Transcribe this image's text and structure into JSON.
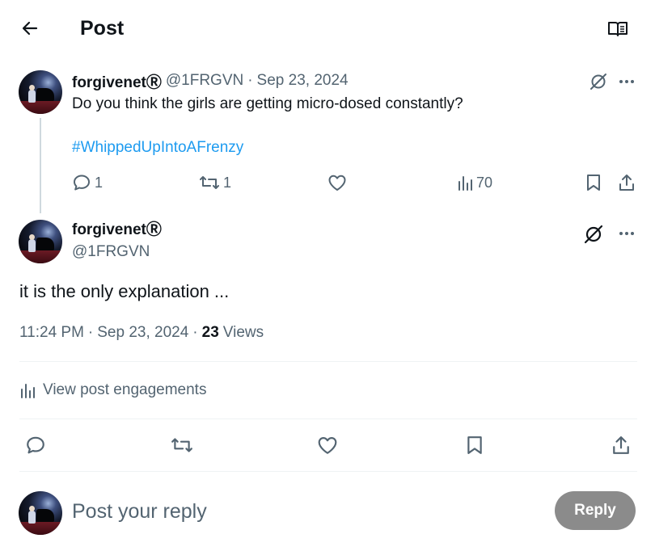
{
  "header": {
    "title": "Post",
    "back_icon": "arrow-left-icon",
    "reader_icon": "book-open-icon"
  },
  "parent_post": {
    "author_name": "forgivenetⓇ",
    "handle": "@1FRGVN",
    "separator": "·",
    "date": "Sep 23, 2024",
    "text": "Do you think the girls are getting micro-dosed constantly?",
    "hashtag": "#WhippedUpIntoAFrenzy",
    "replies": "1",
    "reposts": "1",
    "views": "70"
  },
  "main_post": {
    "author_name": "forgivenetⓇ",
    "handle": "@1FRGVN",
    "text": "it is the only explanation ...",
    "time": "11:24 PM",
    "separator": "·",
    "date": "Sep 23, 2024",
    "views_count": "23",
    "views_label": "Views",
    "engagements_label": "View post engagements"
  },
  "reply_box": {
    "placeholder": "Post your reply",
    "button_label": "Reply"
  },
  "colors": {
    "text": "#0f1419",
    "muted": "#536471",
    "link": "#1d9bf0",
    "divider": "#eff3f4",
    "thread_line": "#cfd9de",
    "reply_button_bg": "#8b8b8b"
  }
}
